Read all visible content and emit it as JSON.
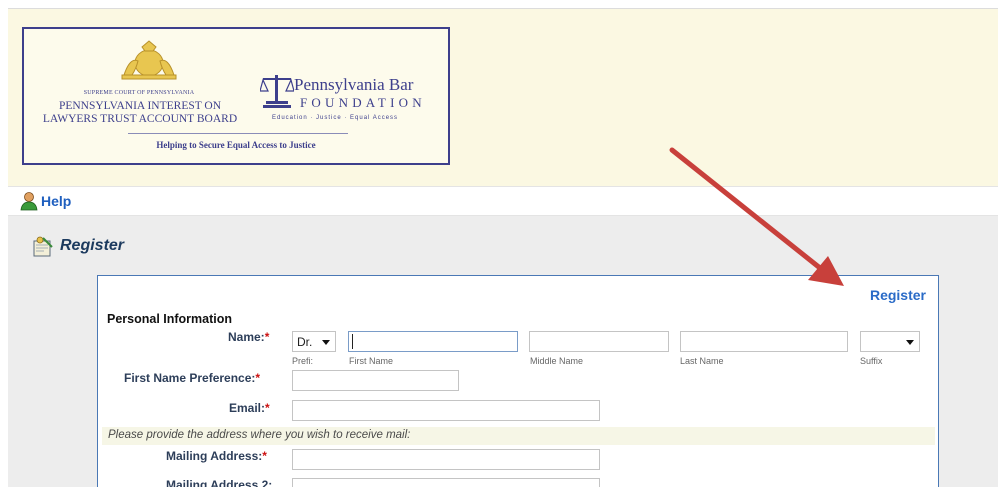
{
  "banner": {
    "court_small": "SUPREME COURT OF PENNSYLVANIA",
    "court_line1": "PENNSYLVANIA INTEREST ON",
    "court_line2": "LAWYERS TRUST ACCOUNT BOARD",
    "foundation_title": "Pennsylvania Bar",
    "foundation_subtitle": "FOUNDATION",
    "foundation_tagline": "Education · Justice · Equal Access",
    "motto": "Helping to Secure Equal Access to Justice"
  },
  "help_bar": {
    "label": "Help"
  },
  "page": {
    "title": "Register",
    "register_link": "Register"
  },
  "form": {
    "section_title": "Personal Information",
    "required_marker": "*",
    "name": {
      "label": "Name:",
      "prefix_value": "Dr.",
      "prefix_caption": "Prefi:",
      "first_caption": "First Name",
      "middle_caption": "Middle Name",
      "last_caption": "Last Name",
      "suffix_caption": "Suffix",
      "suffix_value": ""
    },
    "first_name_pref": {
      "label": "First Name Preference:"
    },
    "email": {
      "label": "Email:"
    },
    "address_notice": "Please provide the address where you wish to receive mail:",
    "mailing_address": {
      "label": "Mailing Address:"
    },
    "mailing_address2": {
      "label": "Mailing Address 2:"
    }
  },
  "colors": {
    "banner_border": "#3d3f8c",
    "link_blue": "#2a6bc7",
    "required_red": "#cc1111",
    "arrow_red": "#c8403b"
  },
  "icons": [
    "seal-icon",
    "scales-icon",
    "help-person-icon",
    "register-book-icon",
    "chevron-down-icon",
    "annotation-arrow"
  ]
}
